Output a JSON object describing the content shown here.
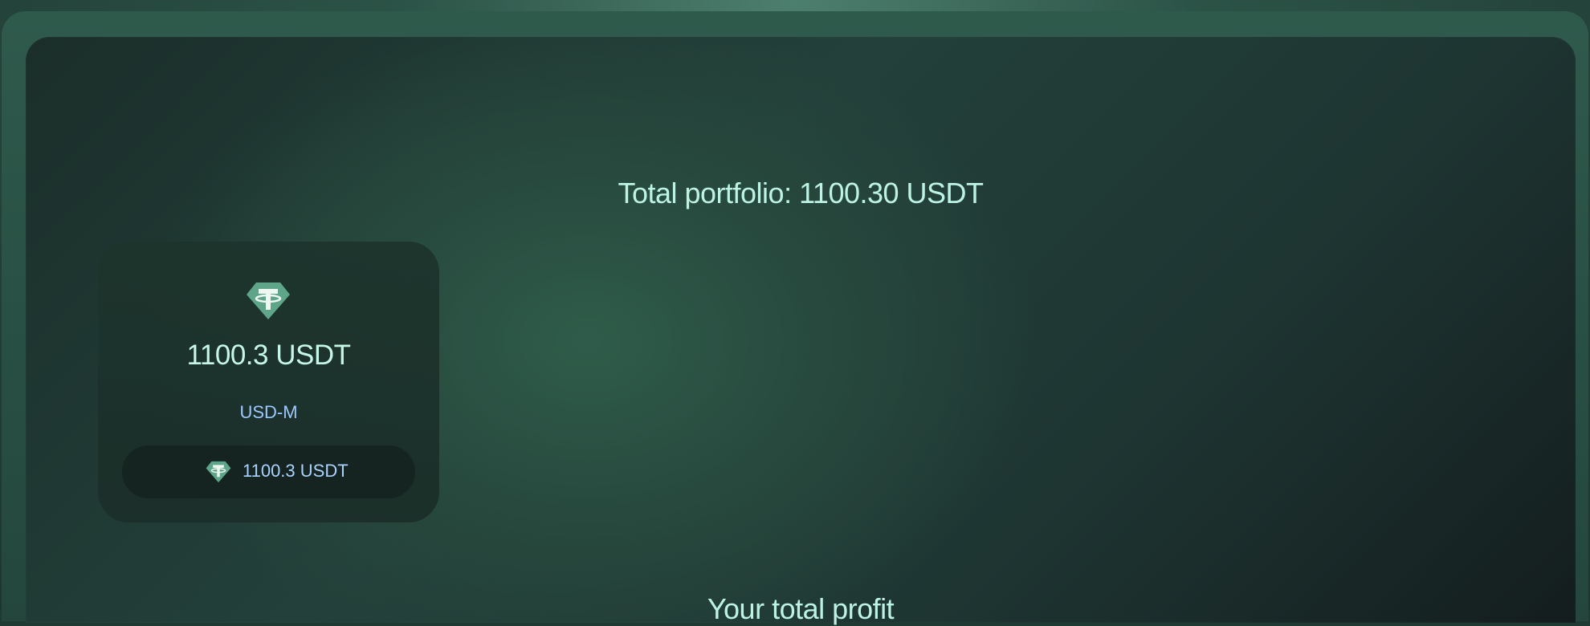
{
  "portfolio": {
    "title": "Total portfolio: 1100.30 USDT"
  },
  "wallet_card": {
    "coin_icon": "tether-icon",
    "amount": "1100.3 USDT",
    "type": "USD-M",
    "balance": {
      "coin_icon": "tether-icon",
      "amount": "1100.3 USDT"
    }
  },
  "profit": {
    "title": "Your total profit"
  },
  "colors": {
    "accent_text": "#bdf3e4",
    "secondary_text": "#9cc8ff",
    "tether_green": "#5fa58a"
  }
}
